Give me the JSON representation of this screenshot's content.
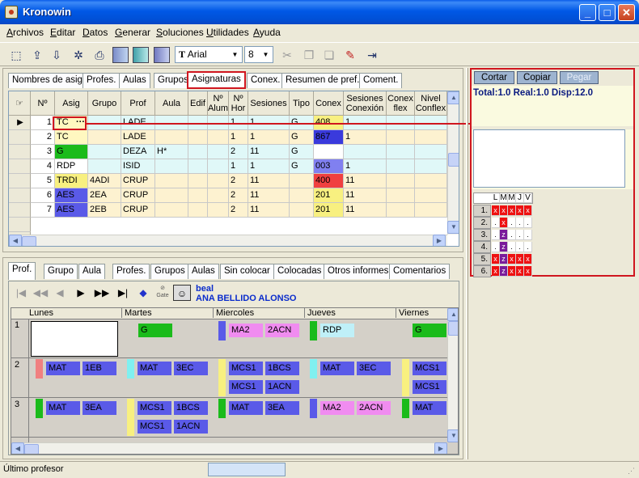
{
  "window": {
    "title": "Kronowin"
  },
  "menu": [
    "Archivos",
    "Editar",
    "Datos",
    "Generar",
    "Soluciones",
    "Utilidades",
    "Ayuda"
  ],
  "toolbar": {
    "font": "Arial",
    "size": "8"
  },
  "top_tabs": [
    "Nombres de asig",
    "Profes.",
    "Aulas",
    "Grupos",
    "Asignaturas",
    "Conex.",
    "Resumen de pref.",
    "Coment."
  ],
  "grid": {
    "headers": [
      "Nº",
      "Asig",
      "Grupo",
      "Prof",
      "Aula",
      "Edif",
      "Nº Alum",
      "Nº Hor",
      "Sesiones",
      "Tipo",
      "Conex",
      "Sesiones Conexión",
      "Conex flex",
      "Nivel Conflex"
    ],
    "rows": [
      {
        "n": "1",
        "asig": "TC",
        "grupo": "",
        "prof": "LADE",
        "aula": "",
        "hor": "1",
        "ses": "1",
        "tipo": "G",
        "conex": "408",
        "sescon": "1"
      },
      {
        "n": "2",
        "asig": "TC",
        "grupo": "",
        "prof": "LADE",
        "aula": "",
        "hor": "1",
        "ses": "1",
        "tipo": "G",
        "conex": "867",
        "sescon": "1"
      },
      {
        "n": "3",
        "asig": "G",
        "grupo": "",
        "prof": "DEZA",
        "aula": "H*",
        "hor": "2",
        "ses": "11",
        "tipo": "G",
        "conex": "",
        "sescon": ""
      },
      {
        "n": "4",
        "asig": "RDP",
        "grupo": "",
        "prof": "ISID",
        "aula": "",
        "hor": "1",
        "ses": "1",
        "tipo": "G",
        "conex": "003",
        "sescon": "1"
      },
      {
        "n": "5",
        "asig": "TRDI",
        "grupo": "4ADI",
        "prof": "CRUP",
        "aula": "",
        "hor": "2",
        "ses": "11",
        "tipo": "",
        "conex": "400",
        "sescon": "11"
      },
      {
        "n": "6",
        "asig": "AES",
        "grupo": "2EA",
        "prof": "CRUP",
        "aula": "",
        "hor": "2",
        "ses": "11",
        "tipo": "",
        "conex": "201",
        "sescon": "11"
      },
      {
        "n": "7",
        "asig": "AES",
        "grupo": "2EB",
        "prof": "CRUP",
        "aula": "",
        "hor": "2",
        "ses": "11",
        "tipo": "",
        "conex": "201",
        "sescon": "11"
      }
    ],
    "ellipsis": "···"
  },
  "bottom_tabs": [
    "Prof.",
    "Grupo",
    "Aula",
    "Profes.",
    "Grupos",
    "Aulas",
    "Sin colocar",
    "Colocadas",
    "Otros informes",
    "Comentarios"
  ],
  "teacher": {
    "code": "beal",
    "name": "ANA BELLIDO ALONSO",
    "gate": "Gate"
  },
  "days": [
    "Lunes",
    "Martes",
    "Miercoles",
    "Jueves",
    "Viernes"
  ],
  "periods": [
    "1",
    "2",
    "3"
  ],
  "timetable": {
    "p1": {
      "martes": "G",
      "miercoles_a": "MA2",
      "miercoles_b": "2ACN",
      "jueves": "RDP",
      "viernes": "G"
    },
    "p2": {
      "lunes_a": "MAT",
      "lunes_b": "1EB",
      "martes_a": "MAT",
      "martes_b": "3EC",
      "miercoles_a": "MCS1",
      "miercoles_b": "1BCS",
      "miercoles_c": "MCS1",
      "miercoles_d": "1ACN",
      "jueves_a": "MAT",
      "jueves_b": "3EC",
      "viernes_a": "MCS1",
      "viernes_b": "MCS1"
    },
    "p3": {
      "lunes_a": "MAT",
      "lunes_b": "3EA",
      "martes_a": "MCS1",
      "martes_b": "1BCS",
      "martes_c": "MCS1",
      "martes_d": "1ACN",
      "miercoles_a": "MAT",
      "miercoles_b": "3EA",
      "jueves_a": "MA2",
      "jueves_b": "2ACN",
      "viernes_a": "MAT"
    }
  },
  "right_panel": {
    "buttons": [
      "Cortar",
      "Copiar",
      "Pegar"
    ],
    "totals": "Total:1.0 Real:1.0 Disp:12.0",
    "matrix_cols": [
      "L",
      "M",
      "M",
      "J",
      "V"
    ],
    "matrix_rows": [
      [
        "x",
        "x",
        "x",
        "x",
        "x"
      ],
      [
        ".",
        "x",
        ".",
        ".",
        "."
      ],
      [
        ".",
        "z",
        ".",
        ".",
        "."
      ],
      [
        ".",
        "z",
        ".",
        ".",
        "."
      ],
      [
        "x",
        "z",
        "x",
        "x",
        "x"
      ],
      [
        "x",
        "z",
        "x",
        "x",
        "x"
      ]
    ]
  },
  "status": {
    "text": "Último profesor"
  }
}
